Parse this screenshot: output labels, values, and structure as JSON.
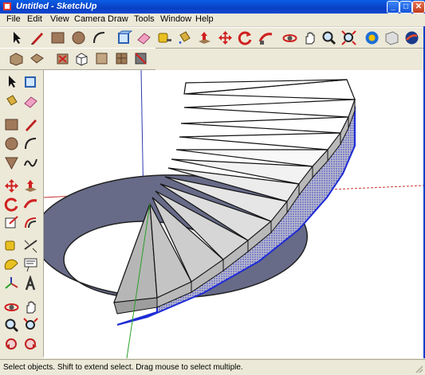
{
  "window": {
    "title": "Untitled - SketchUp"
  },
  "window_controls": {
    "minimize": "_",
    "maximize": "□",
    "close": "✕"
  },
  "menu": [
    "File",
    "Edit",
    "View",
    "Camera",
    "Draw",
    "Tools",
    "Window",
    "Help"
  ],
  "toolbar_row1_icons": [
    "select-arrow-icon",
    "pencil-line-icon",
    "rectangle-icon",
    "circle-icon",
    "arc-icon",
    "make-component-icon",
    "eraser-icon",
    "tape-measure-icon",
    "paint-bucket-icon",
    "push-pull-icon",
    "move-icon",
    "rotate-icon",
    "follow-me-icon",
    "orbit-icon",
    "pan-icon",
    "zoom-icon",
    "zoom-extents-icon",
    "get-models-icon",
    "share-model-icon",
    "google-earth-icon"
  ],
  "toolbar_row2_icons": [
    "iso-view-icon",
    "top-view-icon",
    "x-ray-icon",
    "hidden-line-icon",
    "shaded-icon",
    "shaded-texture-icon",
    "monochrome-icon"
  ],
  "left_toolbar_icons": [
    "select-arrow-icon",
    "make-component-icon",
    "paint-bucket-icon",
    "eraser-icon",
    "rectangle-icon",
    "line-icon",
    "circle-icon",
    "arc-icon",
    "polygon-icon",
    "freehand-icon",
    "move-icon",
    "push-pull-icon",
    "rotate-icon",
    "follow-me-icon",
    "scale-icon",
    "offset-icon",
    "tape-measure-icon",
    "dimension-icon",
    "protractor-icon",
    "text-icon",
    "axes-icon",
    "3d-text-icon",
    "orbit-icon",
    "pan-icon",
    "zoom-icon",
    "zoom-window-icon",
    "previous-view-icon",
    "next-view-icon"
  ],
  "status": {
    "text": "Select objects. Shift to extend select. Drag mouse to select multiple."
  },
  "colors": {
    "titlebar": "#0a3fc4",
    "ring": "#676b88",
    "step_top": "#ffffff",
    "step_riser": "#b9b9b9",
    "selection": "#1e2bd6",
    "axis_red": "#c23232",
    "axis_green": "#2aa02a",
    "axis_blue": "#2a3ab0"
  }
}
